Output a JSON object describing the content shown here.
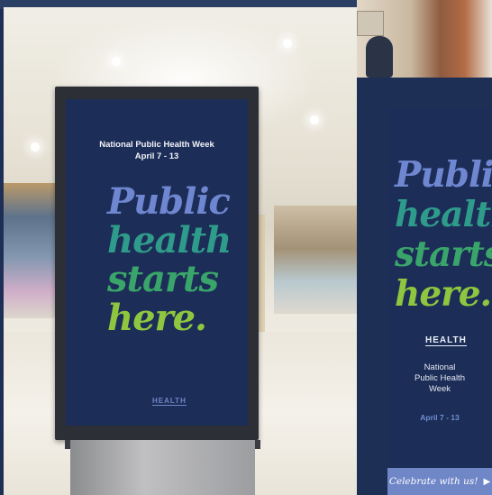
{
  "poster": {
    "event_line1": "National Public Health Week",
    "event_line2": "April 7 - 13",
    "slogan": [
      "Public",
      "health",
      "starts",
      "here."
    ],
    "logo_text": "HEALTH"
  },
  "banner": {
    "slogan": [
      "Public",
      "health",
      "starts",
      "here."
    ],
    "logo_text": "HEALTH",
    "event_lines": [
      "National",
      "Public Health",
      "Week"
    ],
    "dates": "April 7 - 13",
    "cta_label": "Celebrate with us!"
  },
  "colors": {
    "navy": "#1c2d57",
    "blue": "#6f86d0",
    "teal": "#2f9b8a",
    "green": "#3aa56a",
    "lime": "#8ec63f",
    "cta": "#6f86c7"
  },
  "icons": {
    "cta_arrow": "play-arrow-icon"
  }
}
